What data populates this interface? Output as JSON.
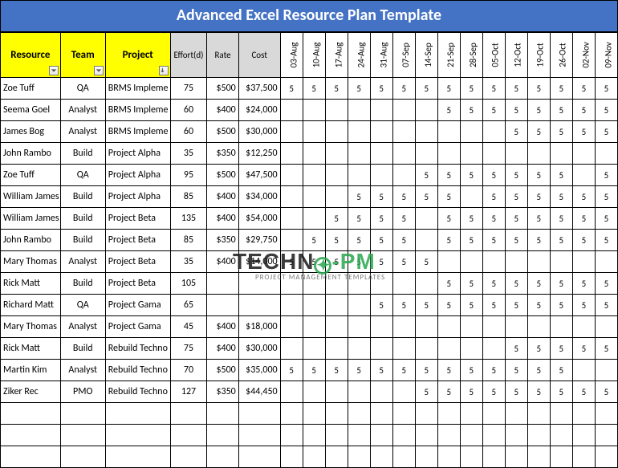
{
  "title": "Advanced Excel Resource Plan Template",
  "headers": {
    "resource": "Resource",
    "team": "Team",
    "project": "Project",
    "effort": "Effort(d)",
    "rate": "Rate",
    "cost": "Cost"
  },
  "dates": [
    "03-Aug",
    "10-Aug",
    "17-Aug",
    "24-Aug",
    "31-Aug",
    "07-Sep",
    "14-Sep",
    "21-Sep",
    "28-Sep",
    "05-Oct",
    "12-Oct",
    "19-Oct",
    "26-Oct",
    "02-Nov",
    "09-Nov"
  ],
  "rows": [
    {
      "resource": "Zoe Tuff",
      "team": "QA",
      "project": "BRMS Impleme",
      "effort": "75",
      "rate": "$500",
      "cost": "$37,500",
      "d": [
        "5",
        "5",
        "5",
        "5",
        "5",
        "5",
        "5",
        "5",
        "5",
        "5",
        "5",
        "5",
        "5",
        "5",
        "5"
      ]
    },
    {
      "resource": "Seema Goel",
      "team": "Analyst",
      "project": "BRMS Impleme",
      "effort": "60",
      "rate": "$400",
      "cost": "$24,000",
      "d": [
        "",
        "",
        "",
        "",
        "",
        "",
        "",
        "5",
        "5",
        "5",
        "5",
        "5",
        "5",
        "5",
        "5"
      ]
    },
    {
      "resource": "James Bog",
      "team": "Analyst",
      "project": "BRMS Impleme",
      "effort": "60",
      "rate": "$500",
      "cost": "$30,000",
      "d": [
        "",
        "",
        "",
        "",
        "",
        "",
        "",
        "",
        "",
        "",
        "5",
        "5",
        "5",
        "5",
        "5"
      ]
    },
    {
      "resource": "John Rambo",
      "team": "Build",
      "project": "Project Alpha",
      "effort": "35",
      "rate": "$350",
      "cost": "$12,250",
      "d": [
        "",
        "",
        "",
        "",
        "",
        "",
        "",
        "",
        "",
        "",
        "",
        "",
        "",
        "",
        ""
      ]
    },
    {
      "resource": "Zoe Tuff",
      "team": "QA",
      "project": "Project Alpha",
      "effort": "95",
      "rate": "$500",
      "cost": "$47,500",
      "d": [
        "",
        "",
        "",
        "",
        "",
        "",
        "5",
        "5",
        "5",
        "5",
        "5",
        "5",
        "5",
        "",
        "5"
      ]
    },
    {
      "resource": "William James",
      "team": "Build",
      "project": "Project Alpha",
      "effort": "85",
      "rate": "$400",
      "cost": "$34,000",
      "d": [
        "",
        "",
        "",
        "5",
        "5",
        "5",
        "5",
        "5",
        "",
        "5",
        "5",
        "5",
        "5",
        "5",
        "5"
      ]
    },
    {
      "resource": "William James",
      "team": "Build",
      "project": "Project Beta",
      "effort": "135",
      "rate": "$400",
      "cost": "$54,000",
      "d": [
        "",
        "",
        "5",
        "5",
        "5",
        "5",
        "",
        "5",
        "5",
        "5",
        "5",
        "5",
        "5",
        "5",
        "5"
      ]
    },
    {
      "resource": "John Rambo",
      "team": "Build",
      "project": "Project Beta",
      "effort": "85",
      "rate": "$350",
      "cost": "$29,750",
      "d": [
        "",
        "5",
        "5",
        "5",
        "5",
        "5",
        "",
        "5",
        "5",
        "5",
        "5",
        "5",
        "5",
        "5",
        "5"
      ]
    },
    {
      "resource": "Mary Thomas",
      "team": "Analyst",
      "project": "Project Beta",
      "effort": "35",
      "rate": "$400",
      "cost": "$14,000",
      "d": [
        "5",
        "5",
        "5",
        "5",
        "5",
        "5",
        "5",
        "",
        "",
        "",
        "",
        "",
        "",
        "",
        ""
      ]
    },
    {
      "resource": "Rick Matt",
      "team": "Build",
      "project": "Project Beta",
      "effort": "105",
      "rate": "",
      "cost": "",
      "d": [
        "",
        "",
        "",
        "",
        "",
        "",
        "",
        "5",
        "5",
        "5",
        "5",
        "5",
        "5",
        "5",
        "5"
      ]
    },
    {
      "resource": "Richard Matt",
      "team": "QA",
      "project": "Project Gama",
      "effort": "65",
      "rate": "",
      "cost": "",
      "d": [
        "",
        "",
        "",
        "",
        "5",
        "5",
        "5",
        "5",
        "5",
        "5",
        "5",
        "5",
        "5",
        "5",
        "5"
      ]
    },
    {
      "resource": "Mary Thomas",
      "team": "Analyst",
      "project": "Project Gama",
      "effort": "45",
      "rate": "$400",
      "cost": "$18,000",
      "d": [
        "",
        "",
        "",
        "",
        "",
        "",
        "",
        "",
        "",
        "",
        "",
        "",
        "",
        "",
        ""
      ]
    },
    {
      "resource": "Rick Matt",
      "team": "Build",
      "project": "Rebuild Techno",
      "effort": "75",
      "rate": "$400",
      "cost": "$30,000",
      "d": [
        "",
        "",
        "",
        "",
        "",
        "",
        "",
        "",
        "",
        "",
        "5",
        "5",
        "5",
        "5",
        "5"
      ]
    },
    {
      "resource": "Martin Kim",
      "team": "Analyst",
      "project": "Rebuild Techno",
      "effort": "70",
      "rate": "$500",
      "cost": "$35,000",
      "d": [
        "5",
        "5",
        "5",
        "5",
        "5",
        "5",
        "5",
        "5",
        "5",
        "5",
        "5",
        "5",
        "5",
        "",
        ""
      ]
    },
    {
      "resource": "Ziker Rec",
      "team": "PMO",
      "project": "Rebuild Techno",
      "effort": "127",
      "rate": "$350",
      "cost": "$44,450",
      "d": [
        "",
        "",
        "",
        "",
        "",
        "",
        "5",
        "5",
        "5",
        "5",
        "5",
        "5",
        "5",
        "5",
        "5"
      ]
    }
  ],
  "empty_rows": 3,
  "watermark": {
    "part1": "TECHN",
    "part2": "-PM",
    "sub": "PROJECT MANAGEMENT TEMPLATES"
  }
}
